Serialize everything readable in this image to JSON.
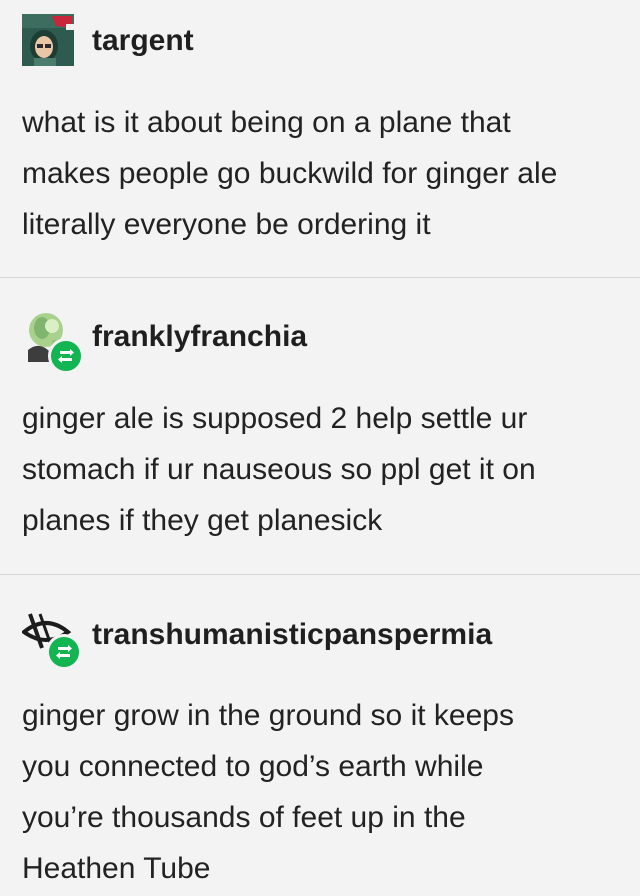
{
  "posts": [
    {
      "username": "targent",
      "lines": [
        "what is it about being on a plane that",
        "makes people go buckwild for ginger ale",
        "literally everyone be ordering it"
      ],
      "avatar_icon": "pixel-art-girl-santa-hat-avatar"
    },
    {
      "username": "franklyfranchia",
      "lines": [
        "ginger ale is supposed 2 help settle ur",
        "stomach if ur nauseous so ppl get it on",
        "planes if they get planesick"
      ],
      "avatar_icon": "green-character-avatar"
    },
    {
      "username": "transhumanisticpanspermia",
      "lines": [
        "ginger grow in the ground so it keeps",
        "you connected to god’s earth while",
        "you’re thousands of feet up in the",
        "Heathen Tube"
      ],
      "avatar_icon": "eye-symbol-avatar"
    }
  ],
  "colors": {
    "background": "#f3f3f3",
    "text": "#222222",
    "divider": "#d6d6d6",
    "reblog_green": "#13b452"
  }
}
